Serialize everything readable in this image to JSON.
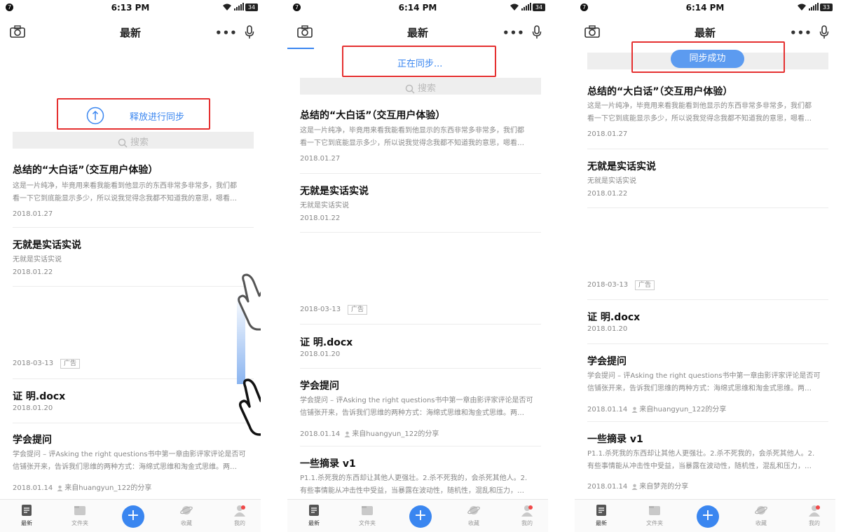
{
  "status": [
    {
      "notif": "7",
      "time": "6:13 PM",
      "battery": "34"
    },
    {
      "notif": "7",
      "time": "6:14 PM",
      "battery": "34"
    },
    {
      "notif": "7",
      "time": "6:14 PM",
      "battery": "33"
    }
  ],
  "header": {
    "title": "最新"
  },
  "search": {
    "placeholder": "搜索"
  },
  "sync": {
    "release_label": "释放进行同步",
    "syncing_label": "正在同步...",
    "success_label": "同步成功"
  },
  "articles": [
    {
      "title": "总结的“大白话”（交互用户体验）",
      "snippet_line1": "这是一片纯净，毕竟用来看我能看到他显示的东西非常多非常多，我们都",
      "snippet_line2": "看一下它到底能显示多少，所以说我觉得念我都不知道我的意思，嗯看…",
      "date": "2018.01.27"
    },
    {
      "title": "无就是实话实说",
      "snippet_line1": "无就是实话实说",
      "date": "2018.01.22"
    },
    {
      "title": "证 明.docx",
      "date": "2018.01.20"
    },
    {
      "title": "学会提问",
      "snippet_line1": "学会提问 – 评Asking the right questions书中第一章由影评家评论是否可",
      "snippet_line2": "信铺张开来，告诉我们思维的两种方式：海绵式思维和淘金式思维。两…",
      "date": "2018.01.14",
      "author": "来自huangyun_122的分享"
    },
    {
      "title": "一些摘录 v1",
      "snippet_line1": "P1.1.杀死我的东西却让其他人更强壮。2.杀不死我的，会杀死其他人。2.",
      "snippet_line2": "有些事情能从冲击性中受益，当暴露在波动性，随机性，混乱和压力，…",
      "date": "2018.01.14",
      "author": "来自梦尧的分享"
    }
  ],
  "ad": {
    "date": "2018-03-13",
    "badge": "广告"
  },
  "tabs": [
    {
      "label": "最新",
      "icon": "document-icon"
    },
    {
      "label": "文件夹",
      "icon": "folder-icon"
    },
    {
      "label": "+",
      "icon": "add-icon"
    },
    {
      "label": "收藏",
      "icon": "planet-icon"
    },
    {
      "label": "我的",
      "icon": "profile-icon"
    }
  ],
  "colors": {
    "accent": "#3a86f0",
    "frame": "#e53030",
    "badge": "#f04848"
  }
}
